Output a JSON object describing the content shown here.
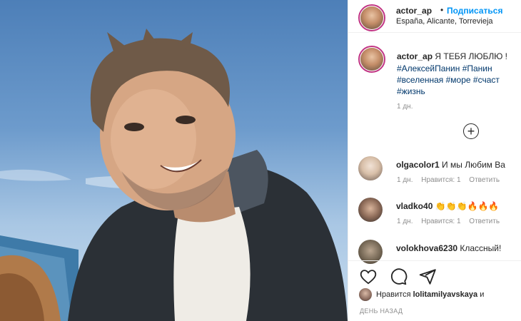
{
  "post": {
    "username": "actor_ap",
    "separator": "•",
    "follow_label": "Подписаться",
    "location": "España, Alicante, Torrevieja"
  },
  "caption": {
    "username": "actor_ap",
    "text": "Я ТЕБЯ ЛЮБЛЮ !",
    "hashtags": [
      "#АлексейПанин #Панин",
      "#вселенная #море #счаст",
      "#жизнь"
    ],
    "time": "1 дн."
  },
  "comments": [
    {
      "username": "olgacolor1",
      "text": "И мы Любим Ва",
      "time": "1 дн.",
      "likes": "Нравится: 1",
      "reply": "Ответить"
    },
    {
      "username": "vladko40",
      "text": "👏👏👏🔥🔥🔥",
      "time": "1 дн.",
      "likes": "Нравится: 1",
      "reply": "Ответить"
    },
    {
      "username": "volokhova6230",
      "text": "Классный!"
    }
  ],
  "likes_line": {
    "prefix": "Нравится",
    "user": "lolitamilyavskaya",
    "suffix": "и"
  },
  "date_label": "ДЕНЬ НАЗАД",
  "colors": {
    "accent": "#0095f6",
    "ring": "#c13584",
    "muted": "#8e8e8e"
  }
}
